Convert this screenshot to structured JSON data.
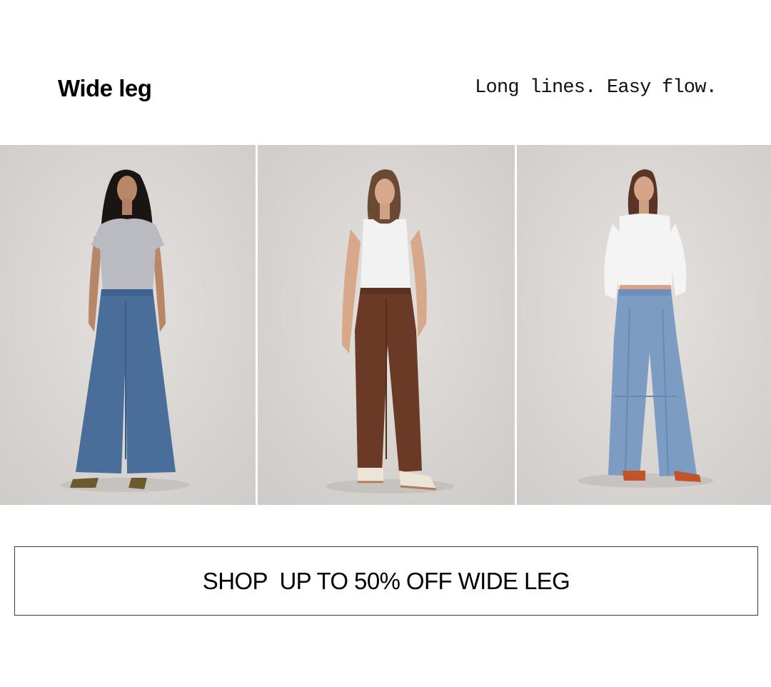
{
  "header": {
    "title": "Wide leg",
    "tagline": "Long lines. Easy flow."
  },
  "gallery": {
    "items": [
      {
        "id": "model-1",
        "top": "grey tee",
        "bottom": "medium wash wide leg jeans",
        "shoes": "olive heeled boots",
        "colors": {
          "bg": "#d9d5d2",
          "top": "#b9bbc0",
          "denim": "#4a6e9a",
          "shoes": "#6a5a2e",
          "hair": "#1a1412"
        }
      },
      {
        "id": "model-2",
        "top": "white tank",
        "bottom": "brown straight leg pants",
        "shoes": "cream sneakers",
        "colors": {
          "bg": "#d8d4d1",
          "top": "#f2f2f2",
          "denim": "#6a3a26",
          "shoes": "#ece4d6",
          "hair": "#6a4a34"
        }
      },
      {
        "id": "model-3",
        "top": "white long sleeve",
        "bottom": "light wash seamed wide leg jeans",
        "shoes": "orange sneakers",
        "colors": {
          "bg": "#dad6d3",
          "top": "#f4f4f4",
          "denim": "#7d9cc4",
          "shoes": "#c2542a",
          "hair": "#5a3424"
        }
      }
    ]
  },
  "cta": {
    "label": "SHOP  UP TO 50% OFF WIDE LEG"
  }
}
